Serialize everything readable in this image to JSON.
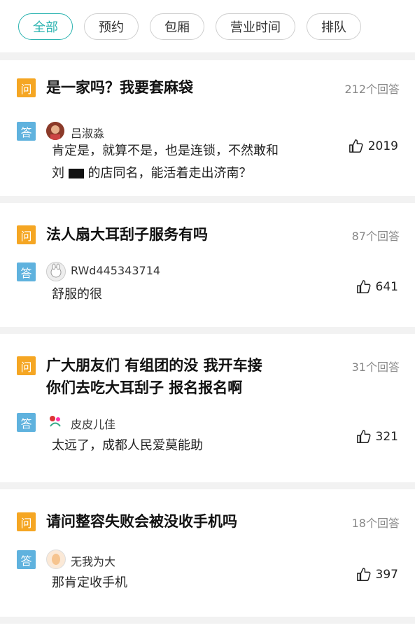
{
  "tabs": [
    "全部",
    "预约",
    "包厢",
    "营业时间",
    "排队"
  ],
  "colors": {
    "accent": "#2bb3b0",
    "question_badge": "#f5a623",
    "answer_badge": "#5fb2de"
  },
  "badges": {
    "question": "问",
    "answer": "答"
  },
  "items": [
    {
      "question": "是一家吗？我要套麻袋",
      "answer_count": "212个回答",
      "user": "吕淑淼",
      "answer_line1": "肯定是，就算不是，也是连锁，不然敢和",
      "answer_line2_prefix": "刘",
      "answer_line2_suffix": "的店同名，能活着走出济南？",
      "likes": "2019"
    },
    {
      "question": "法人扇大耳刮子服务有吗",
      "answer_count": "87个回答",
      "user": "RWd445343714",
      "answer": "舒服的很",
      "likes": "641"
    },
    {
      "question_line1": "广大朋友们 有组团的没 我开车接",
      "question_line2": "你们去吃大耳刮子 报名报名啊",
      "answer_count": "31个回答",
      "user": "皮皮儿佳",
      "answer": "太远了，成都人民爱莫能助",
      "likes": "321"
    },
    {
      "question": "请问整容失败会被没收手机吗",
      "answer_count": "18个回答",
      "user": "无我为大",
      "answer": "那肯定收手机",
      "likes": "397"
    }
  ]
}
